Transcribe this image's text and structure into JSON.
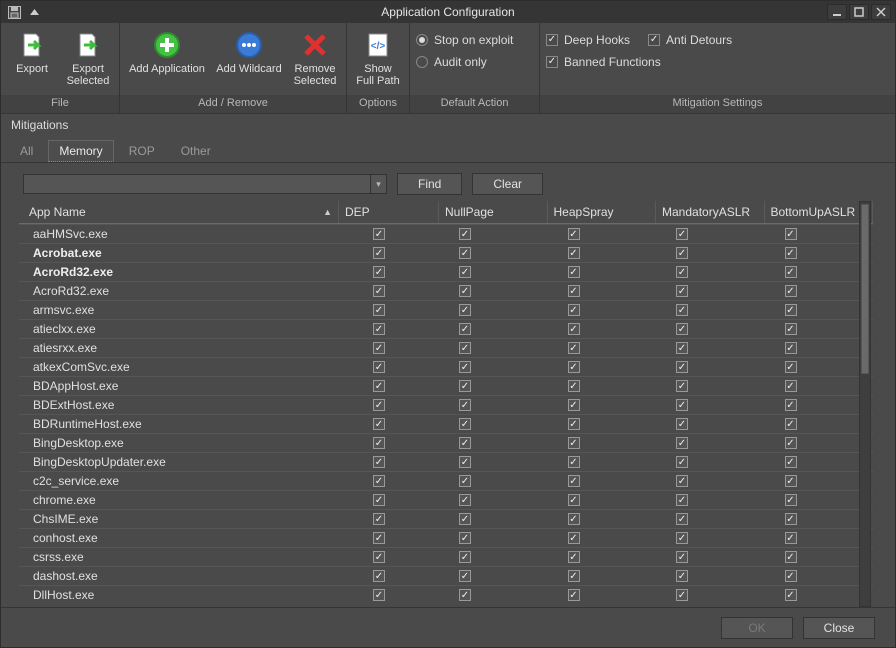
{
  "title": "Application Configuration",
  "ribbon": {
    "file": {
      "label": "File",
      "export": "Export",
      "export_selected": "Export Selected"
    },
    "add_remove": {
      "label": "Add / Remove",
      "add_app": "Add Application",
      "add_wildcard": "Add Wildcard",
      "remove_selected": "Remove Selected"
    },
    "options": {
      "label": "Options",
      "show_full_path": "Show Full Path"
    },
    "default_action": {
      "label": "Default Action",
      "stop_on_exploit": "Stop on exploit",
      "audit_only": "Audit only",
      "selected": "stop_on_exploit"
    },
    "mitigation": {
      "label": "Mitigation Settings",
      "deep_hooks": "Deep Hooks",
      "anti_detours": "Anti Detours",
      "banned_functions": "Banned Functions",
      "deep_hooks_on": true,
      "anti_detours_on": true,
      "banned_functions_on": true
    }
  },
  "panel_title": "Mitigations",
  "tabs": {
    "all": "All",
    "memory": "Memory",
    "rop": "ROP",
    "other": "Other",
    "active": "memory"
  },
  "search": {
    "find": "Find",
    "clear": "Clear",
    "value": ""
  },
  "columns": [
    "App Name",
    "DEP",
    "NullPage",
    "HeapSpray",
    "MandatoryASLR",
    "BottomUpASLR"
  ],
  "sort_column": 0,
  "rows": [
    {
      "name": "aaHMSvc.exe",
      "bold": false,
      "current": true,
      "checks": [
        true,
        true,
        true,
        true,
        true
      ]
    },
    {
      "name": "Acrobat.exe",
      "bold": true,
      "current": false,
      "checks": [
        true,
        true,
        true,
        true,
        true
      ]
    },
    {
      "name": "AcroRd32.exe",
      "bold": true,
      "current": false,
      "checks": [
        true,
        true,
        true,
        true,
        true
      ]
    },
    {
      "name": "AcroRd32.exe",
      "bold": false,
      "current": false,
      "checks": [
        true,
        true,
        true,
        true,
        true
      ]
    },
    {
      "name": "armsvc.exe",
      "bold": false,
      "current": false,
      "checks": [
        true,
        true,
        true,
        true,
        true
      ]
    },
    {
      "name": "atieclxx.exe",
      "bold": false,
      "current": false,
      "checks": [
        true,
        true,
        true,
        true,
        true
      ]
    },
    {
      "name": "atiesrxx.exe",
      "bold": false,
      "current": false,
      "checks": [
        true,
        true,
        true,
        true,
        true
      ]
    },
    {
      "name": "atkexComSvc.exe",
      "bold": false,
      "current": false,
      "checks": [
        true,
        true,
        true,
        true,
        true
      ]
    },
    {
      "name": "BDAppHost.exe",
      "bold": false,
      "current": false,
      "checks": [
        true,
        true,
        true,
        true,
        true
      ]
    },
    {
      "name": "BDExtHost.exe",
      "bold": false,
      "current": false,
      "checks": [
        true,
        true,
        true,
        true,
        true
      ]
    },
    {
      "name": "BDRuntimeHost.exe",
      "bold": false,
      "current": false,
      "checks": [
        true,
        true,
        true,
        true,
        true
      ]
    },
    {
      "name": "BingDesktop.exe",
      "bold": false,
      "current": false,
      "checks": [
        true,
        true,
        true,
        true,
        true
      ]
    },
    {
      "name": "BingDesktopUpdater.exe",
      "bold": false,
      "current": false,
      "checks": [
        true,
        true,
        true,
        true,
        true
      ]
    },
    {
      "name": "c2c_service.exe",
      "bold": false,
      "current": false,
      "checks": [
        true,
        true,
        true,
        true,
        true
      ]
    },
    {
      "name": "chrome.exe",
      "bold": false,
      "current": false,
      "checks": [
        true,
        true,
        true,
        true,
        true
      ]
    },
    {
      "name": "ChsIME.exe",
      "bold": false,
      "current": false,
      "checks": [
        true,
        true,
        true,
        true,
        true
      ]
    },
    {
      "name": "conhost.exe",
      "bold": false,
      "current": false,
      "checks": [
        true,
        true,
        true,
        true,
        true
      ]
    },
    {
      "name": "csrss.exe",
      "bold": false,
      "current": false,
      "checks": [
        true,
        true,
        true,
        true,
        true
      ]
    },
    {
      "name": "dashost.exe",
      "bold": false,
      "current": false,
      "checks": [
        true,
        true,
        true,
        true,
        true
      ]
    },
    {
      "name": "DllHost.exe",
      "bold": false,
      "current": false,
      "checks": [
        true,
        true,
        true,
        true,
        true
      ]
    }
  ],
  "footer": {
    "ok": "OK",
    "close": "Close"
  }
}
